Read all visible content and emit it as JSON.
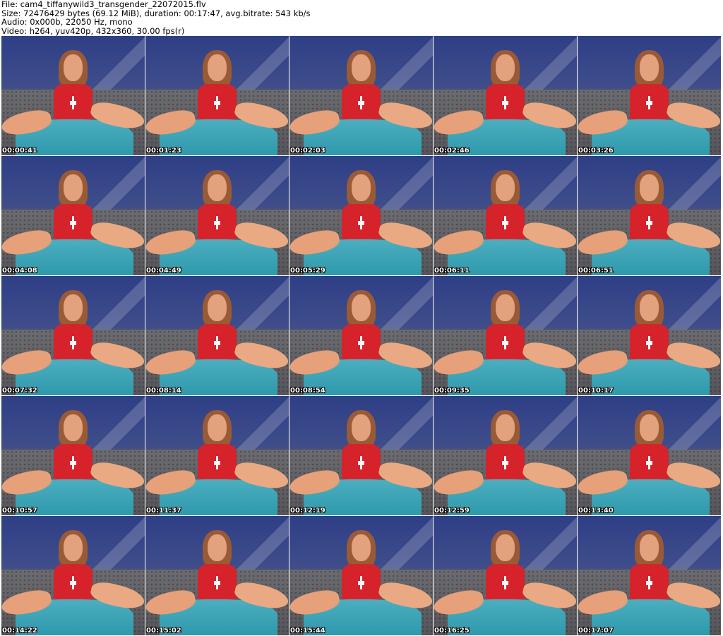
{
  "header": {
    "line1": "File: cam4_tiffanywild3_transgender_22072015.flv",
    "line2": "Size: 72476429 bytes (69.12 MiB), duration: 00:17:47, avg.bitrate: 543 kb/s",
    "line3": "Audio: 0x000b, 22050 Hz, mono",
    "line4": "Video: h264, yuv420p, 432x360, 30.00 fps(r)"
  },
  "thumbnails": [
    {
      "timestamp": "00:00:41"
    },
    {
      "timestamp": "00:01:23"
    },
    {
      "timestamp": "00:02:03"
    },
    {
      "timestamp": "00:02:46"
    },
    {
      "timestamp": "00:03:26"
    },
    {
      "timestamp": "00:04:08"
    },
    {
      "timestamp": "00:04:49"
    },
    {
      "timestamp": "00:05:29"
    },
    {
      "timestamp": "00:06:11"
    },
    {
      "timestamp": "00:06:51"
    },
    {
      "timestamp": "00:07:32"
    },
    {
      "timestamp": "00:08:14"
    },
    {
      "timestamp": "00:08:54"
    },
    {
      "timestamp": "00:09:35"
    },
    {
      "timestamp": "00:10:17"
    },
    {
      "timestamp": "00:10:57"
    },
    {
      "timestamp": "00:11:37"
    },
    {
      "timestamp": "00:12:19"
    },
    {
      "timestamp": "00:12:59"
    },
    {
      "timestamp": "00:13:40"
    },
    {
      "timestamp": "00:14:22"
    },
    {
      "timestamp": "00:15:02"
    },
    {
      "timestamp": "00:15:44"
    },
    {
      "timestamp": "00:16:25"
    },
    {
      "timestamp": "00:17:07"
    }
  ]
}
